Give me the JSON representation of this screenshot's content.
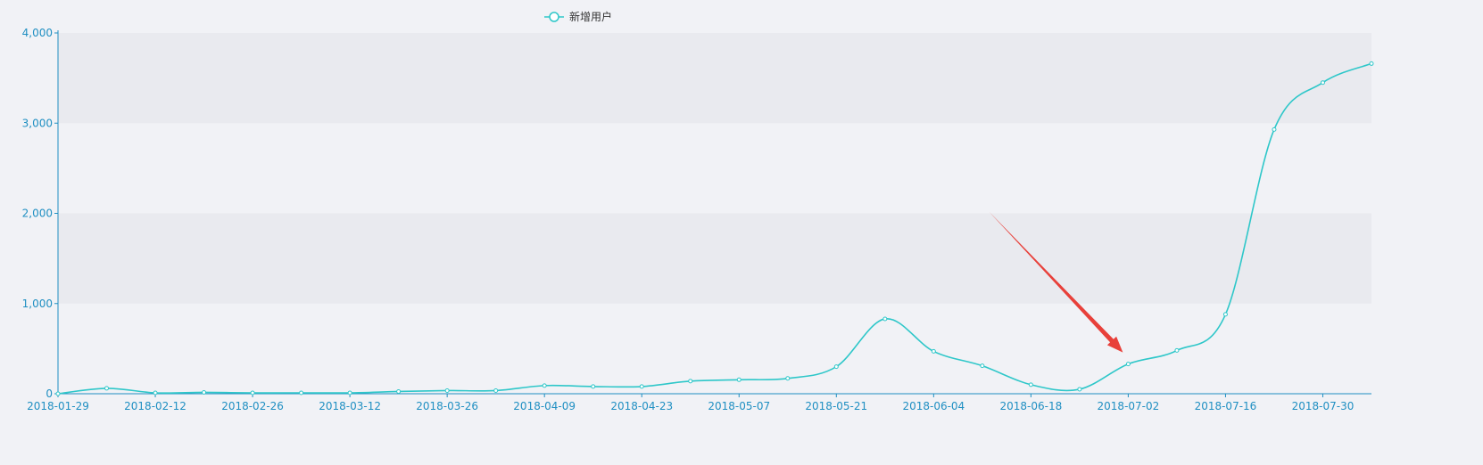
{
  "colors": {
    "series": "#2ec7c9",
    "axis": "#1f8fc2",
    "band": "#e9eaef",
    "background": "#f1f2f6",
    "arrow": "#e8403a"
  },
  "chart_data": {
    "type": "line",
    "smooth": true,
    "title": "",
    "xlabel": "",
    "ylabel": "",
    "ylim": [
      0,
      4000
    ],
    "yticks": [
      0,
      1000,
      2000,
      3000,
      4000
    ],
    "ytick_labels": [
      "0",
      "1,000",
      "2,000",
      "3,000",
      "4,000"
    ],
    "xtick_labels": [
      "2018-01-29",
      "2018-02-12",
      "2018-02-26",
      "2018-03-12",
      "2018-03-26",
      "2018-04-09",
      "2018-04-23",
      "2018-05-07",
      "2018-05-21",
      "2018-06-04",
      "2018-06-18",
      "2018-07-02",
      "2018-07-16",
      "2018-07-30"
    ],
    "grid": "alternating horizontal bands",
    "legend": "top-center",
    "legend_entries": [
      "新增用户"
    ],
    "series": [
      {
        "name": "新增用户",
        "x": [
          "2018-01-29",
          "2018-02-05",
          "2018-02-12",
          "2018-02-19",
          "2018-02-26",
          "2018-03-05",
          "2018-03-12",
          "2018-03-19",
          "2018-03-26",
          "2018-04-02",
          "2018-04-09",
          "2018-04-16",
          "2018-04-23",
          "2018-04-30",
          "2018-05-07",
          "2018-05-14",
          "2018-05-21",
          "2018-05-28",
          "2018-06-04",
          "2018-06-11",
          "2018-06-18",
          "2018-06-25",
          "2018-07-02",
          "2018-07-09",
          "2018-07-16",
          "2018-07-23",
          "2018-07-30",
          "2018-08-06"
        ],
        "values": [
          0,
          60,
          10,
          15,
          10,
          10,
          10,
          25,
          35,
          35,
          90,
          80,
          80,
          140,
          155,
          170,
          300,
          830,
          470,
          310,
          100,
          50,
          330,
          480,
          880,
          2930,
          3450,
          3660
        ]
      }
    ],
    "annotations": [
      {
        "type": "arrow",
        "points_to": "2018-07-02"
      }
    ]
  }
}
